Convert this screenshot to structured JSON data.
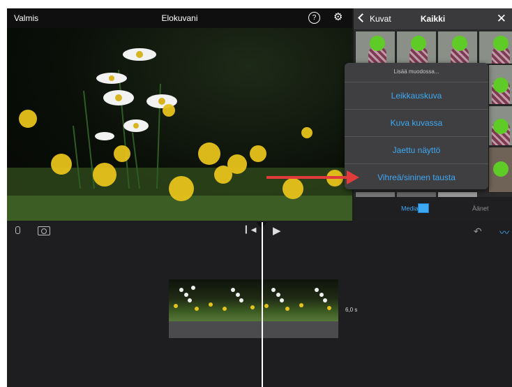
{
  "topbar": {
    "done": "Valmis",
    "title": "Elokuvani",
    "help_icon": "help-icon",
    "settings_icon": "gear-icon"
  },
  "panel": {
    "back": "Kuvat",
    "title": "Kaikki",
    "close": "✕",
    "menu": {
      "title": "Lisää muodossa...",
      "items": [
        "Leikkauskuva",
        "Kuva kuvassa",
        "Jaettu näyttö",
        "Vihreä/sininen tausta"
      ]
    },
    "tabs": {
      "media": "Media",
      "audio": "Äänet"
    }
  },
  "timeline": {
    "clip_duration": "6,0 s"
  },
  "colors": {
    "accent": "#3da9f5",
    "arrow": "#e23b3b",
    "green_dot": "#5ecb26"
  }
}
